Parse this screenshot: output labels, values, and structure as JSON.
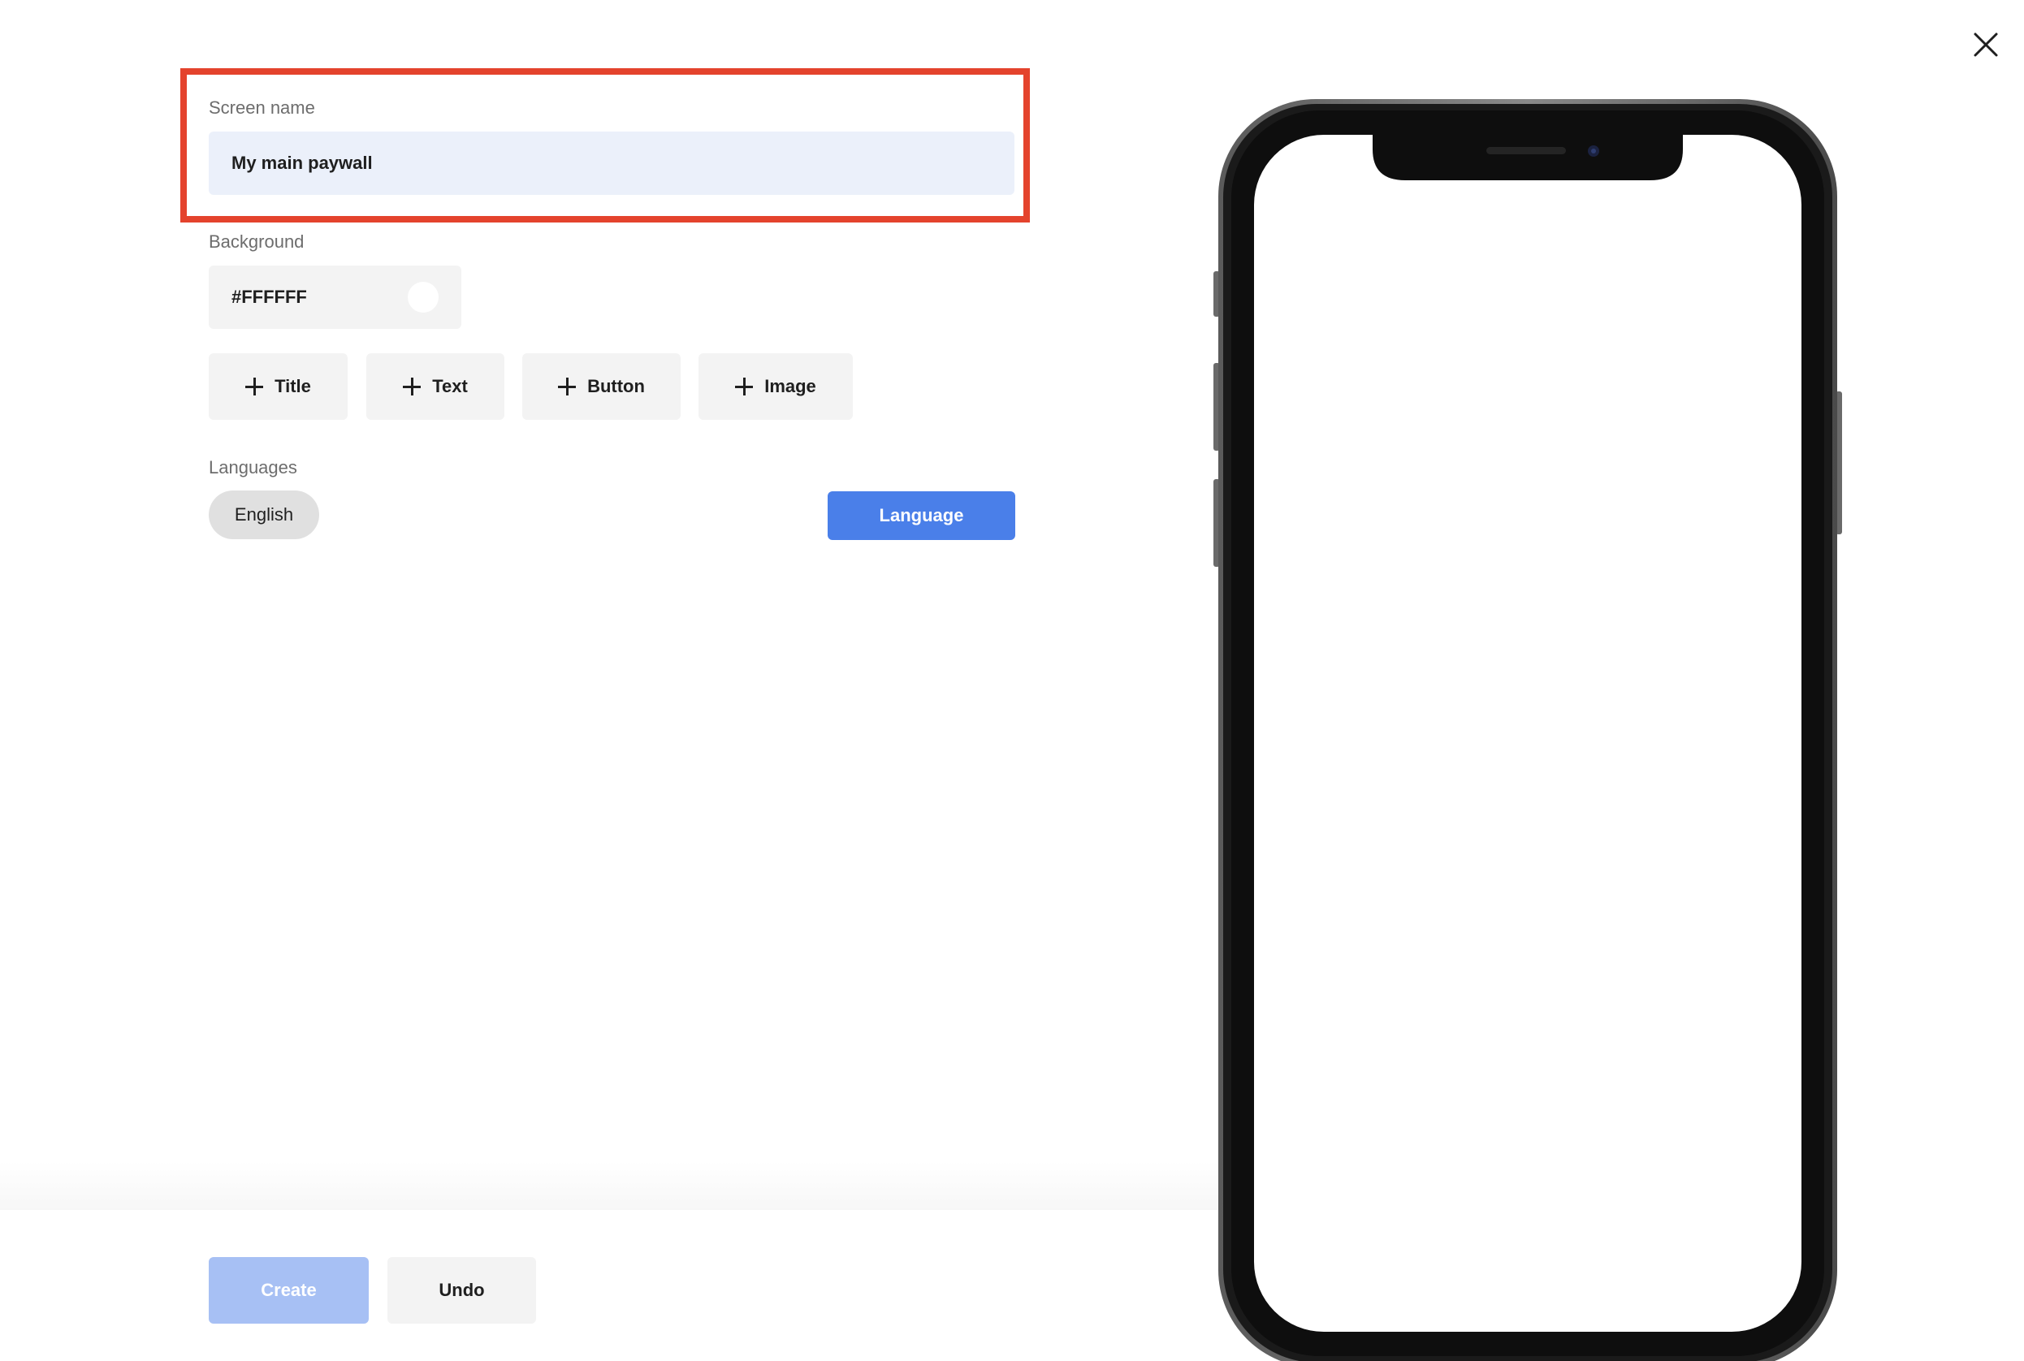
{
  "editor": {
    "screen_name_label": "Screen name",
    "screen_name_value": "My main paywall",
    "background_label": "Background",
    "background_value": "#FFFFFF",
    "background_swatch_color": "#FFFFFF",
    "add_buttons": [
      {
        "label": "Title",
        "icon": "plus-icon"
      },
      {
        "label": "Text",
        "icon": "plus-icon"
      },
      {
        "label": "Button",
        "icon": "plus-icon"
      },
      {
        "label": "Image",
        "icon": "plus-icon"
      }
    ],
    "languages_label": "Languages",
    "languages": [
      "English"
    ],
    "language_button_label": "Language"
  },
  "footer": {
    "create_label": "Create",
    "undo_label": "Undo"
  },
  "window": {
    "close_icon": "close-icon"
  },
  "colors": {
    "highlight": "#e4432d",
    "primary": "#4a7fe9",
    "primary_disabled": "#a7c0f4",
    "input_focused": "#ebf0fa",
    "input": "#f3f3f3"
  },
  "preview": {
    "device": "phone-mockup"
  }
}
